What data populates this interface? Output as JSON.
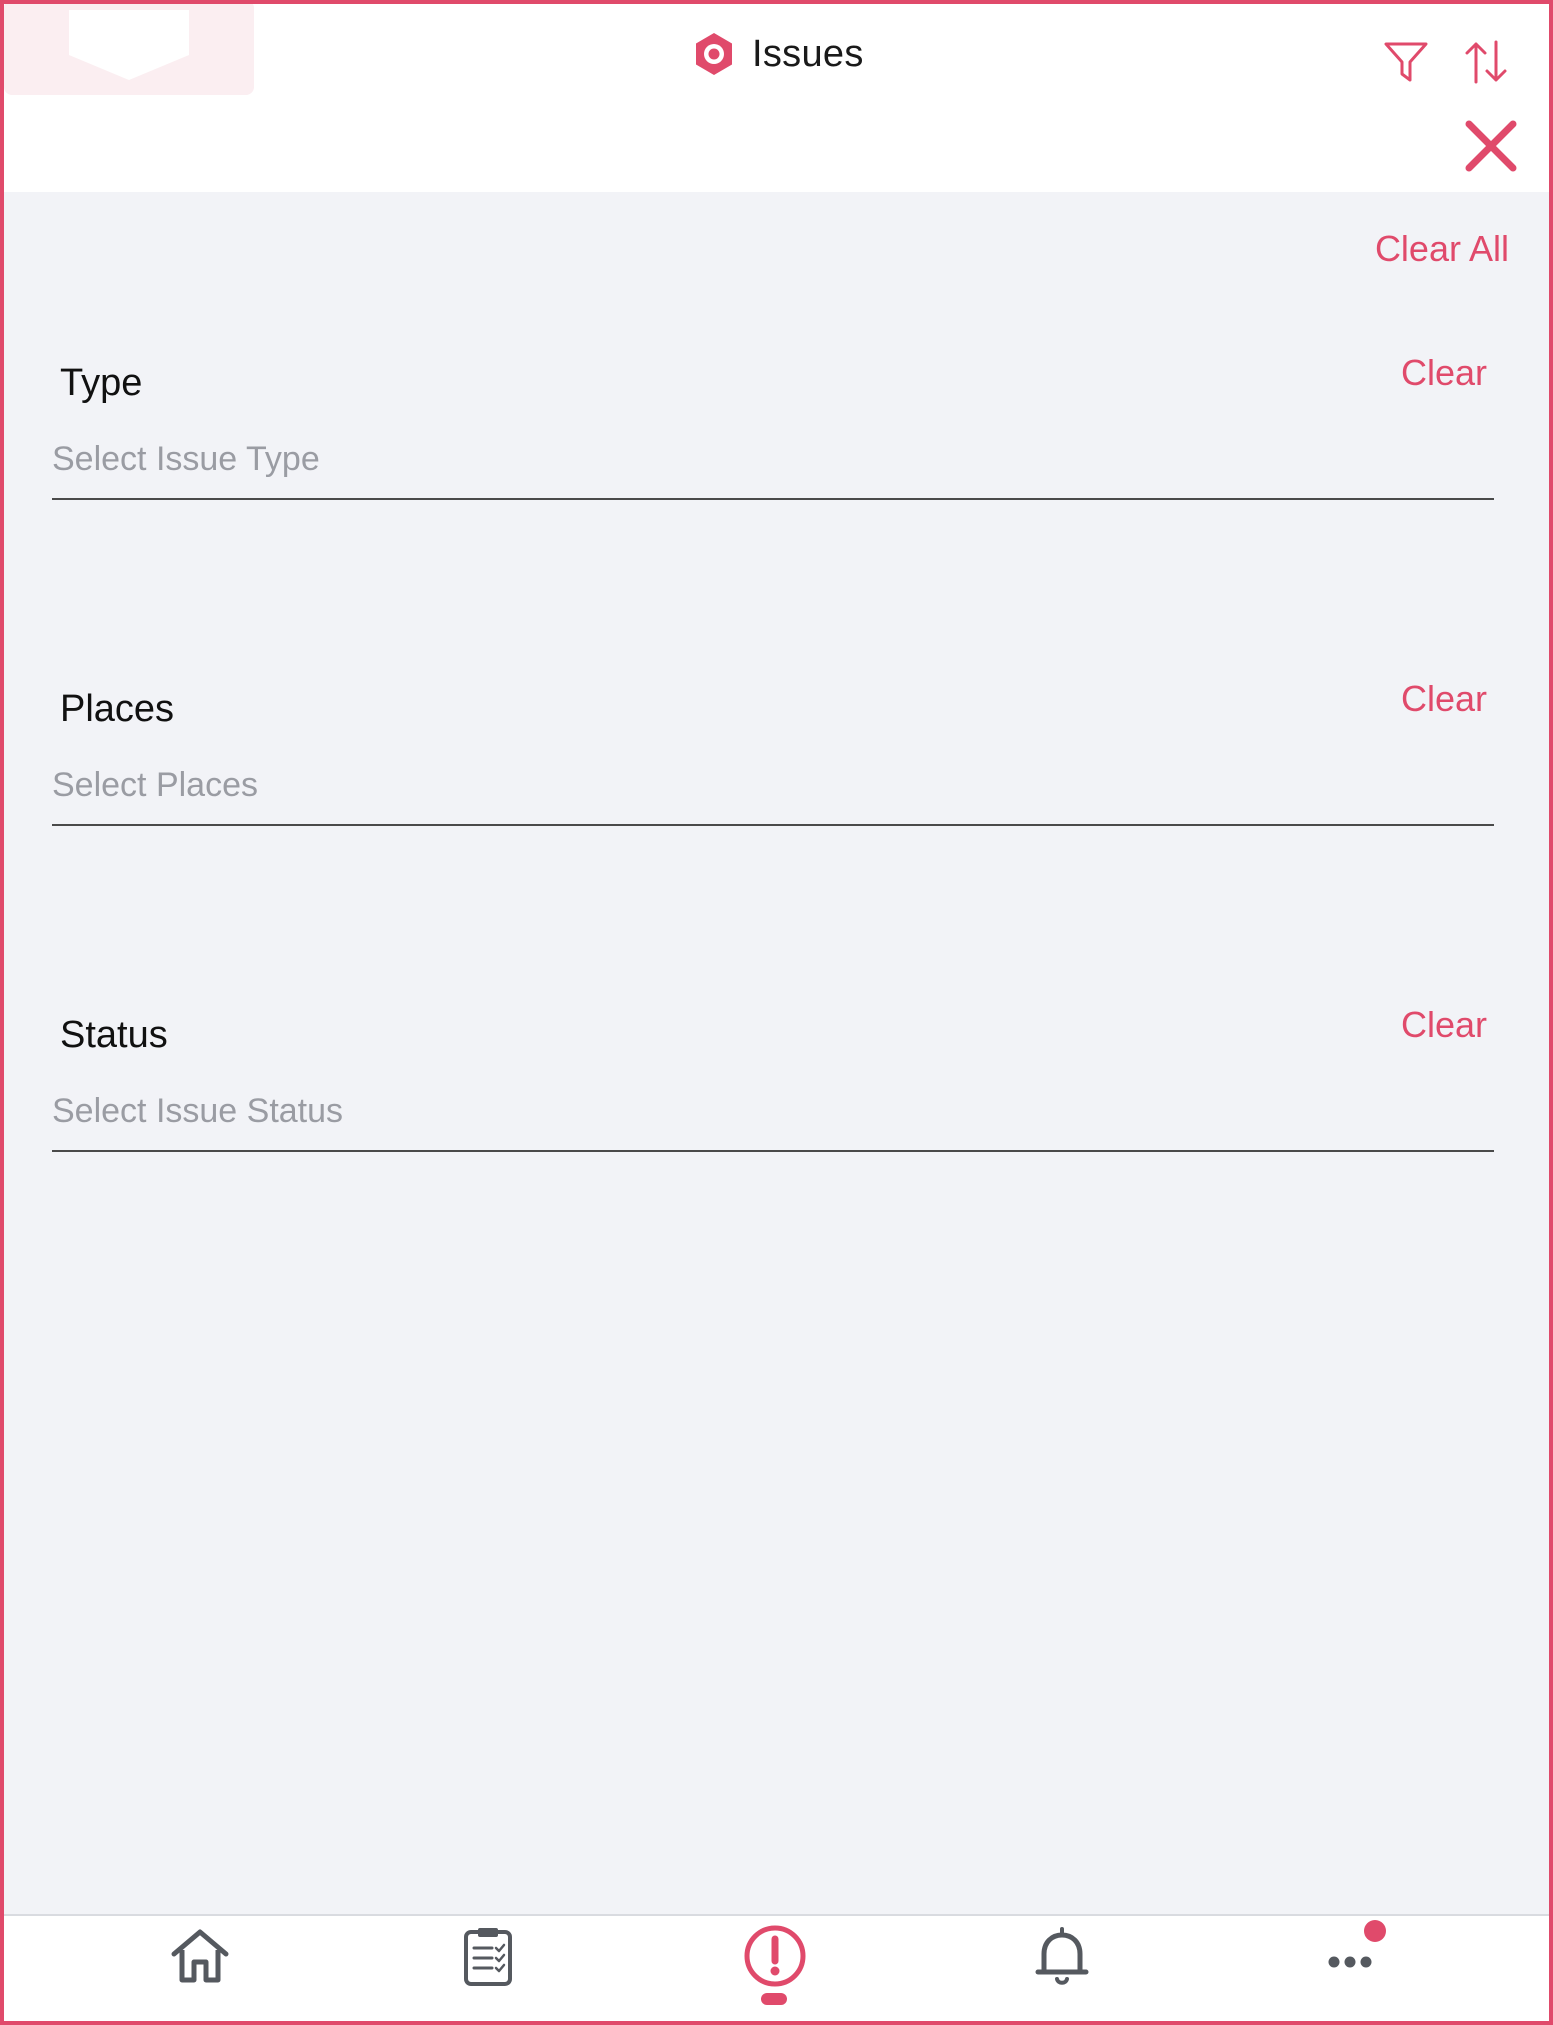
{
  "header": {
    "title": "Issues"
  },
  "clear_all_label": "Clear All",
  "sections": [
    {
      "label": "Type",
      "clear_label": "Clear",
      "placeholder": "Select Issue Type"
    },
    {
      "label": "Places",
      "clear_label": "Clear",
      "placeholder": "Select Places"
    },
    {
      "label": "Status",
      "clear_label": "Clear",
      "placeholder": "Select Issue Status"
    }
  ],
  "nav": {
    "items": [
      "home-icon",
      "checklist-icon",
      "issues-icon",
      "bell-icon",
      "more-icon"
    ],
    "active": "issues-icon",
    "more_has_badge": true
  },
  "colors": {
    "accent": "#e04a6b",
    "background": "#f2f3f7",
    "icon_gray": "#55595f",
    "placeholder": "#9a9ca3"
  }
}
